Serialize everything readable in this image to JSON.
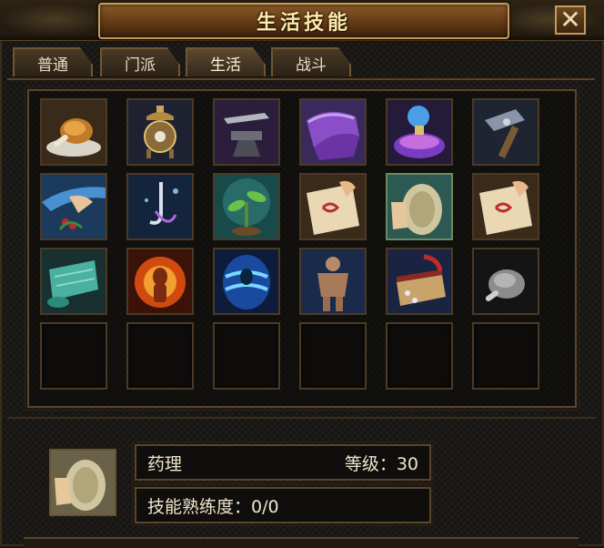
{
  "window": {
    "title": "生活技能",
    "close_label": "✕"
  },
  "tabs": [
    {
      "label": "普通",
      "active": false
    },
    {
      "label": "门派",
      "active": false
    },
    {
      "label": "生活",
      "active": true
    },
    {
      "label": "战斗",
      "active": false
    }
  ],
  "skills": {
    "row1": [
      "roast-meat-icon",
      "alchemy-furnace-icon",
      "anvil-icon",
      "tailoring-cloth-icon",
      "potion-flask-icon",
      "hammer-icon"
    ],
    "row2": [
      "herb-picking-icon",
      "fishing-hook-icon",
      "seedling-icon",
      "scroll-red-seal-icon",
      "grinding-wheel-icon",
      "scroll-red-seal-icon"
    ],
    "row3": [
      "jade-scroll-icon",
      "fire-aura-icon",
      "water-aura-icon",
      "muscle-body-icon",
      "book-crafting-icon",
      "gray-meat-icon"
    ],
    "row4": [
      "empty",
      "empty",
      "empty",
      "empty",
      "empty",
      "empty"
    ]
  },
  "selected_skill": {
    "icon": "grinding-wheel-icon",
    "name": "药理",
    "level_label": "等级：30",
    "proficiency_label": "技能熟练度：0/0"
  }
}
